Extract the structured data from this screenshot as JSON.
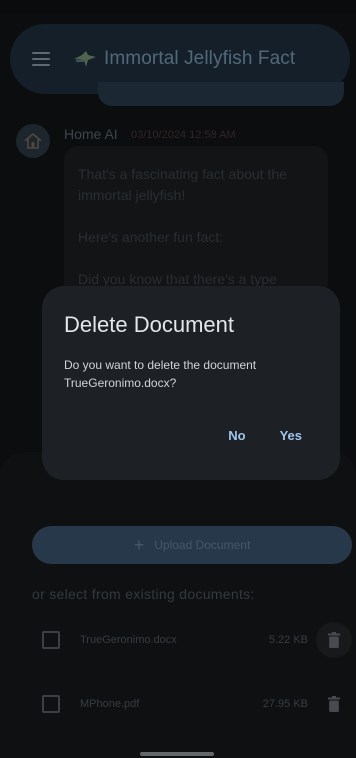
{
  "app": {
    "title": "Immortal Jellyfish Fact"
  },
  "chat": {
    "ai_name": "Home AI",
    "ai_timestamp": "03/10/2024 12:58 AM",
    "ai_message_paragraphs": [
      "That's a fascinating fact about the immortal jellyfish!",
      "Here's another fun fact:",
      "Did you know that there's a type"
    ]
  },
  "documents": {
    "upload_label": "Upload Document",
    "select_existing_label": "or select from existing documents:",
    "items": [
      {
        "name": "TrueGeronimo.docx",
        "size": "5.22 KB",
        "checked": false
      },
      {
        "name": "MPhone.pdf",
        "size": "27.95 KB",
        "checked": false
      }
    ]
  },
  "dialog": {
    "title": "Delete Document",
    "message": "Do you want to delete the document TrueGeronimo.docx?",
    "no_label": "No",
    "yes_label": "Yes"
  },
  "colors": {
    "background": "#131416",
    "appbar": "#1f3140",
    "accent": "#9ec6ea",
    "dialog": "#1d2025"
  },
  "icons": {
    "menu": "hamburger-menu-icon",
    "logo": "jellyfish-logo-icon",
    "avatar": "home-icon",
    "upload": "plus-icon",
    "delete": "trash-icon"
  }
}
